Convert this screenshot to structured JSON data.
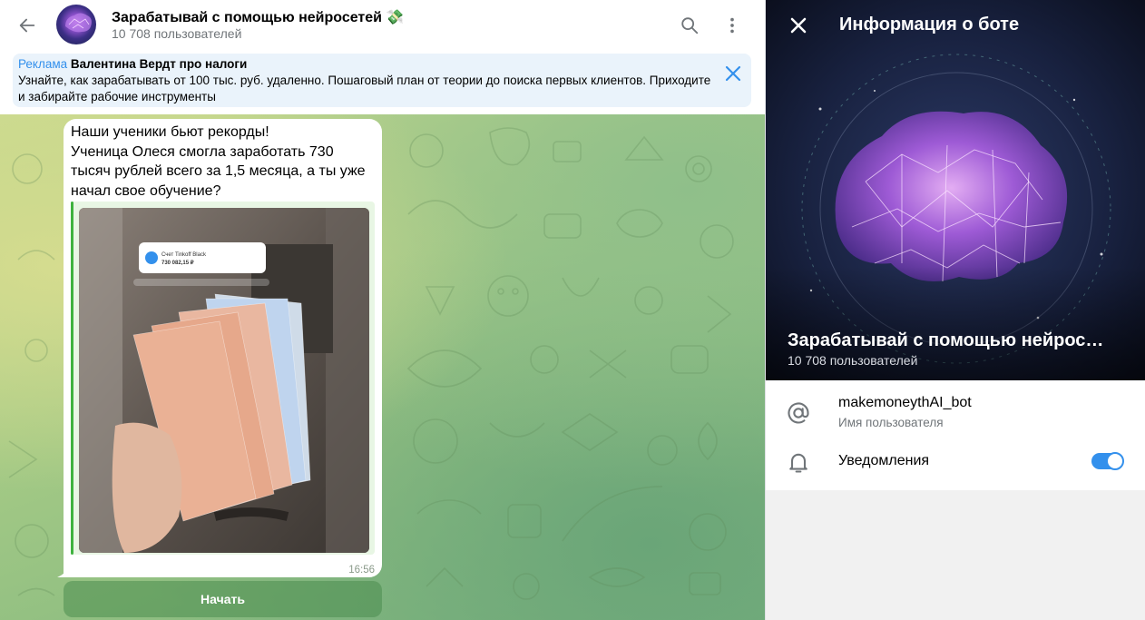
{
  "header": {
    "title": "Зарабатывай с помощью нейросетей 💸",
    "subtitle": "10 708 пользователей"
  },
  "ad": {
    "tag": "Реклама",
    "title": "Валентина Вердт про налоги",
    "text": "Узнайте, как зарабатывать от 100 тыс. руб. удаленно. Пошаговый план от теории до поиска первых клиентов. Приходите и забирайте рабочие инструменты"
  },
  "message": {
    "lines": [
      "Наши ученики бьют рекорды!",
      "Ученица Олеся смогла заработать 730 тысяч рублей всего за 1,5 месяца, а ты уже начал свое обучение?"
    ],
    "photo_card": {
      "account": "Счет Tinkoff Black",
      "amount": "730 082,15 ₽"
    },
    "time": "16:56"
  },
  "start_button": {
    "label": "Начать"
  },
  "panel": {
    "title": "Информация о боте",
    "name": "Зарабатывай с помощью нейросетей 💸",
    "subtitle": "10 708 пользователей",
    "username": "makemoneythAI_bot",
    "username_caption": "Имя пользователя",
    "notifications_label": "Уведомления",
    "notifications_on": true
  },
  "colors": {
    "accent": "#3390ec",
    "quote_green": "#3fb23f",
    "panel_bg": "#f1f1f1"
  },
  "icons": {
    "back": "arrow-left-icon",
    "search": "search-icon",
    "more": "more-vertical-icon",
    "close": "close-icon",
    "at": "at-icon",
    "bell": "bell-icon"
  }
}
